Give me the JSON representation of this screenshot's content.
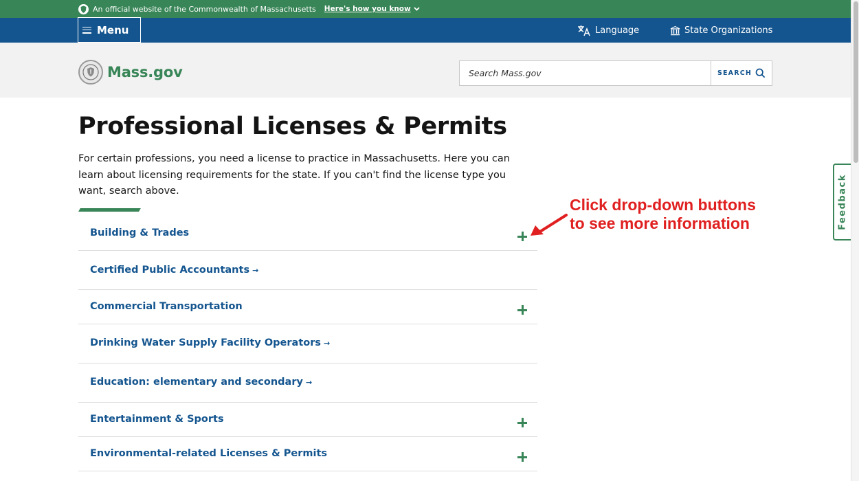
{
  "official_banner": {
    "text": "An official website of the Commonwealth of Massachusetts",
    "how_link": "Here's how you know",
    "icon": "seal-icon",
    "chevron_icon": "chevron-down-icon"
  },
  "nav": {
    "menu_label": "Menu",
    "language_label": "Language",
    "language_icon": "translate-icon",
    "orgs_label": "State Organizations",
    "orgs_icon": "building-icon"
  },
  "header": {
    "logo_text": "Mass.gov",
    "search_placeholder": "Search Mass.gov",
    "search_button": "SEARCH"
  },
  "main": {
    "title": "Professional Licenses & Permits",
    "intro": "For certain professions, you need a license to practice in Massachusetts. Here you can learn about licensing requirements for the state. If you can't find the license type you want, search above.",
    "items": [
      {
        "label": "Building & Trades",
        "kind": "accordion"
      },
      {
        "label": "Certified Public Accountants",
        "kind": "link",
        "arrow": "→"
      },
      {
        "label": "Commercial Transportation",
        "kind": "accordion"
      },
      {
        "label": "Drinking Water Supply Facility Operators",
        "kind": "link",
        "arrow": "→"
      },
      {
        "label": "Education: elementary and secondary",
        "kind": "link",
        "arrow": "→"
      },
      {
        "label": "Entertainment & Sports",
        "kind": "accordion"
      },
      {
        "label": "Environmental-related Licenses & Permits",
        "kind": "accordion"
      }
    ]
  },
  "annotation": {
    "line1": "Click drop-down buttons",
    "line2": "to see more information",
    "color": "#e02020"
  },
  "feedback": {
    "label": "Feedback"
  },
  "colors": {
    "green": "#388557",
    "blue": "#14558f",
    "header_bg": "#f2f2f2"
  }
}
